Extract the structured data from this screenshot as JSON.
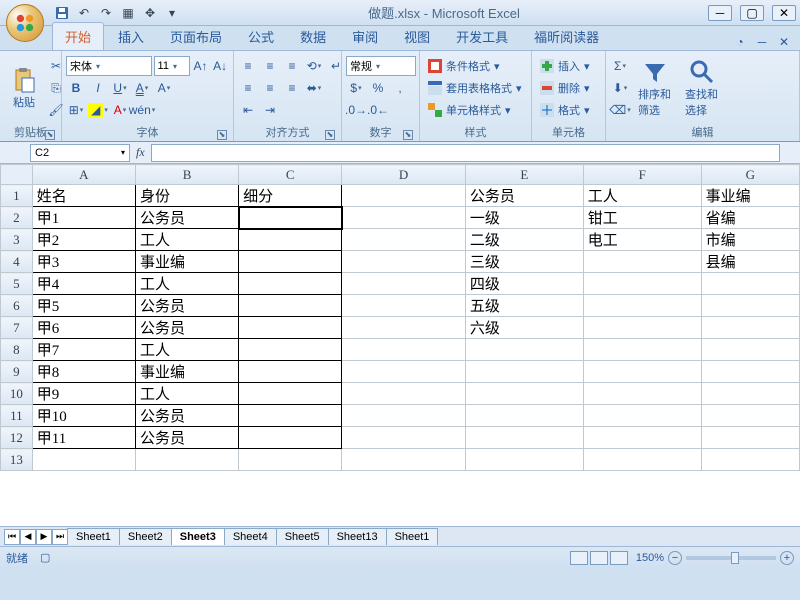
{
  "window": {
    "title": "做题.xlsx - Microsoft Excel"
  },
  "qat": {
    "save": "保存",
    "undo": "撤销",
    "redo": "重做"
  },
  "tabs": {
    "home": "开始",
    "insert": "插入",
    "pagelayout": "页面布局",
    "formulas": "公式",
    "data": "数据",
    "review": "审阅",
    "view": "视图",
    "developer": "开发工具",
    "foxit": "福昕阅读器"
  },
  "ribbon": {
    "clipboard": {
      "label": "剪贴板",
      "paste": "粘贴"
    },
    "font": {
      "label": "字体",
      "name": "宋体",
      "size": "11"
    },
    "alignment": {
      "label": "对齐方式"
    },
    "number": {
      "label": "数字",
      "format": "常规"
    },
    "styles": {
      "label": "样式",
      "cond": "条件格式",
      "table": "套用表格格式",
      "cell": "单元格样式"
    },
    "cells": {
      "label": "单元格",
      "insert": "插入",
      "delete": "删除",
      "format": "格式"
    },
    "editing": {
      "label": "编辑",
      "sort": "排序和\n筛选",
      "find": "查找和\n选择"
    }
  },
  "namebox": {
    "value": "C2"
  },
  "columns": [
    "A",
    "B",
    "C",
    "D",
    "E",
    "F",
    "G"
  ],
  "rows": [
    {
      "n": "1",
      "A": "姓名",
      "B": "身份",
      "C": "细分",
      "E": "公务员",
      "F": "工人",
      "G": "事业编"
    },
    {
      "n": "2",
      "A": "甲1",
      "B": "公务员",
      "C": "",
      "E": "一级",
      "F": "钳工",
      "G": "省编"
    },
    {
      "n": "3",
      "A": "甲2",
      "B": "工人",
      "C": "",
      "E": "二级",
      "F": "电工",
      "G": "市编"
    },
    {
      "n": "4",
      "A": "甲3",
      "B": "事业编",
      "C": "",
      "E": "三级",
      "G": "县编"
    },
    {
      "n": "5",
      "A": "甲4",
      "B": "工人",
      "C": "",
      "E": "四级"
    },
    {
      "n": "6",
      "A": "甲5",
      "B": "公务员",
      "C": "",
      "E": "五级"
    },
    {
      "n": "7",
      "A": "甲6",
      "B": "公务员",
      "C": "",
      "E": "六级"
    },
    {
      "n": "8",
      "A": "甲7",
      "B": "工人",
      "C": ""
    },
    {
      "n": "9",
      "A": "甲8",
      "B": "事业编",
      "C": ""
    },
    {
      "n": "10",
      "A": "甲9",
      "B": "工人",
      "C": ""
    },
    {
      "n": "11",
      "A": "甲10",
      "B": "公务员",
      "C": ""
    },
    {
      "n": "12",
      "A": "甲11",
      "B": "公务员",
      "C": ""
    },
    {
      "n": "13"
    }
  ],
  "sheets": [
    "Sheet1",
    "Sheet2",
    "Sheet3",
    "Sheet4",
    "Sheet5",
    "Sheet13",
    "Sheet1"
  ],
  "activeSheet": "Sheet3",
  "status": {
    "ready": "就绪",
    "rec": "",
    "zoom": "150%"
  }
}
